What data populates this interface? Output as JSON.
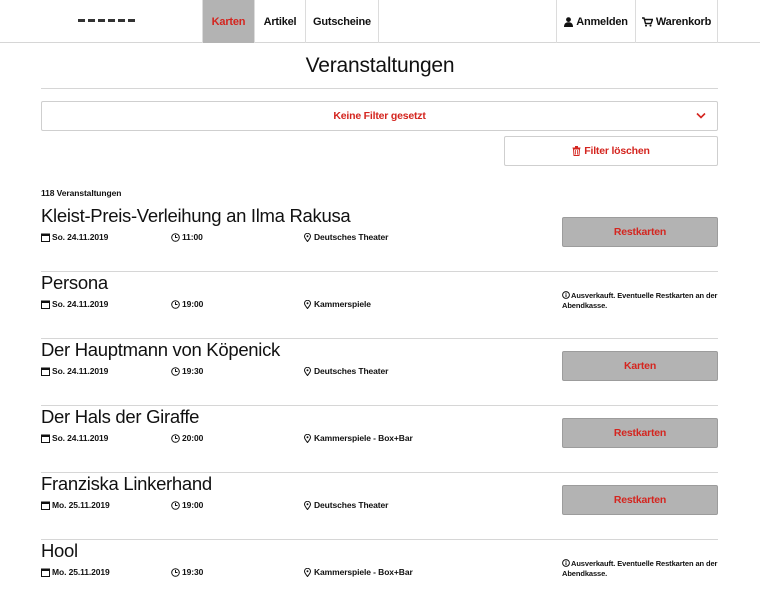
{
  "nav": {
    "items": [
      {
        "label": "Karten",
        "active": true
      },
      {
        "label": "Artikel"
      },
      {
        "label": "Gutscheine"
      }
    ],
    "login_label": "Anmelden",
    "cart_label": "Warenkorb"
  },
  "page": {
    "title": "Veranstaltungen"
  },
  "filter": {
    "select_label": "Keine Filter gesetzt",
    "clear_label": "Filter löschen"
  },
  "results": {
    "count_label": "118 Veranstaltungen"
  },
  "events": [
    {
      "title": "Kleist-Preis-Verleihung an Ilma Rakusa",
      "date": "So. 24.11.2019",
      "time": "11:00",
      "venue": "Deutsches Theater",
      "action": "Restkarten",
      "note": ""
    },
    {
      "title": "Persona",
      "date": "So. 24.11.2019",
      "time": "19:00",
      "venue": "Kammerspiele",
      "action": "",
      "note": "Ausverkauft. Eventuelle Restkarten an der Abendkasse."
    },
    {
      "title": "Der Hauptmann von Köpenick",
      "date": "So. 24.11.2019",
      "time": "19:30",
      "venue": "Deutsches Theater",
      "action": "Karten",
      "note": ""
    },
    {
      "title": "Der Hals der Giraffe",
      "date": "So. 24.11.2019",
      "time": "20:00",
      "venue": "Kammerspiele - Box+Bar",
      "action": "Restkarten",
      "note": ""
    },
    {
      "title": "Franziska Linkerhand",
      "date": "Mo. 25.11.2019",
      "time": "19:00",
      "venue": "Deutsches Theater",
      "action": "Restkarten",
      "note": ""
    },
    {
      "title": "Hool",
      "date": "Mo. 25.11.2019",
      "time": "19:30",
      "venue": "Kammerspiele - Box+Bar",
      "action": "",
      "note": "Ausverkauft. Eventuelle Restkarten an der Abendkasse."
    }
  ],
  "colors": {
    "accent": "#d4251f",
    "button_bg": "#b3b3b3",
    "border": "#d6d6d6"
  },
  "icons": {
    "login": "user-icon",
    "cart": "cart-icon",
    "select": "chevron-down-icon",
    "clear": "trash-icon",
    "date": "calendar-icon",
    "time": "clock-icon",
    "venue": "map-pin-icon",
    "note": "info-icon"
  }
}
